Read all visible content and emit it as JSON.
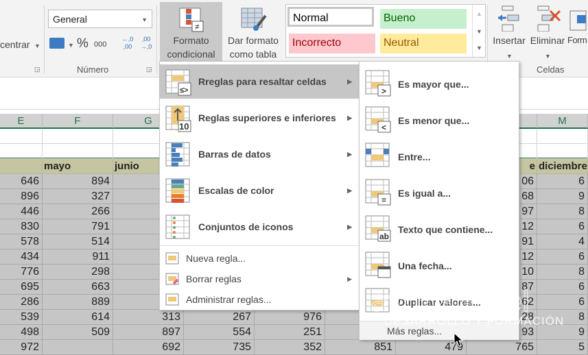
{
  "ribbon": {
    "align_label": "centrar",
    "number_format": "General",
    "percent": "%",
    "thousands": "000",
    "inc_decimal": "←,0 ,00",
    "dec_decimal": ",00 →,0",
    "number_group": "Número",
    "cf_line1": "Formato",
    "cf_line2": "condicional",
    "table_line1": "Dar formato",
    "table_line2": "como tabla",
    "styles": [
      "Normal",
      "Bueno",
      "Incorrecto",
      "Neutral"
    ],
    "style_colors": {
      "normal": "#ffffff",
      "bueno": "#c6efce",
      "incorrecto": "#ffc7ce",
      "neutral": "#ffeb9c"
    },
    "insert": "Insertar",
    "delete": "Eliminar",
    "format": "Form",
    "cells_group": "Celdas"
  },
  "columns": [
    "E",
    "F",
    "G",
    "",
    "",
    "",
    "",
    "",
    "M"
  ],
  "header_row": [
    "",
    "mayo",
    "junio",
    "",
    "",
    "",
    "",
    "e",
    "diciembre"
  ],
  "rows": [
    [
      "646",
      "894",
      "",
      "",
      "",
      "",
      "",
      "06",
      "6"
    ],
    [
      "896",
      "327",
      "",
      "",
      "",
      "",
      "",
      "68",
      "9"
    ],
    [
      "446",
      "266",
      "",
      "",
      "",
      "",
      "",
      "97",
      "8"
    ],
    [
      "830",
      "791",
      "",
      "",
      "",
      "",
      "",
      "12",
      "6"
    ],
    [
      "578",
      "514",
      "",
      "",
      "",
      "",
      "",
      "91",
      "4"
    ],
    [
      "434",
      "911",
      "",
      "",
      "",
      "",
      "",
      "12",
      "6"
    ],
    [
      "776",
      "298",
      "",
      "",
      "",
      "",
      "",
      "10",
      "8"
    ],
    [
      "695",
      "663",
      "",
      "",
      "",
      "",
      "",
      "87",
      "6"
    ],
    [
      "286",
      "889",
      "",
      "",
      "",
      "",
      "",
      "62",
      "6"
    ],
    [
      "539",
      "614",
      "313",
      "267",
      "976",
      "",
      "",
      "28",
      "8"
    ],
    [
      "498",
      "509",
      "897",
      "554",
      "251",
      "",
      "",
      "93",
      "9"
    ],
    [
      "972",
      "",
      "692",
      "735",
      "352",
      "851",
      "479",
      "765",
      "5"
    ]
  ],
  "menu": {
    "items": [
      {
        "label": "Rreglas para resaltar celdas",
        "icon": "highlight-rules-icon"
      },
      {
        "label": "Reglas superiores e inferiores",
        "icon": "top-bottom-rules-icon"
      },
      {
        "label": "Barras de datos",
        "icon": "data-bars-icon"
      },
      {
        "label": "Escalas de color",
        "icon": "color-scales-icon"
      },
      {
        "label": "Conjuntos de iconos",
        "icon": "icon-sets-icon"
      }
    ],
    "small_items": [
      {
        "label": "Nueva regla...",
        "icon": "new-rule-icon"
      },
      {
        "label": "Borrar reglas",
        "icon": "clear-rules-icon"
      },
      {
        "label": "Administrar reglas...",
        "icon": "manage-rules-icon"
      }
    ]
  },
  "submenu": {
    "items": [
      {
        "label": "Es mayor que...",
        "symbol": ">"
      },
      {
        "label": "Es menor que...",
        "symbol": "<"
      },
      {
        "label": "Entre...",
        "symbol": ""
      },
      {
        "label": "Es igual a...",
        "symbol": "="
      },
      {
        "label": "Texto que contiene...",
        "symbol": "ab"
      },
      {
        "label": "Una fecha...",
        "symbol": "cal"
      },
      {
        "label": "Duplicar valores...",
        "symbol": ""
      }
    ],
    "more": "Más reglas..."
  },
  "watermark": {
    "line1": "ayudaexcel",
    "line2": "DESARROLLO Y FORMACIÓN"
  },
  "colors": {
    "accent": "#217346",
    "highlight": "#f0c87a",
    "bar": "#4a7fba"
  }
}
